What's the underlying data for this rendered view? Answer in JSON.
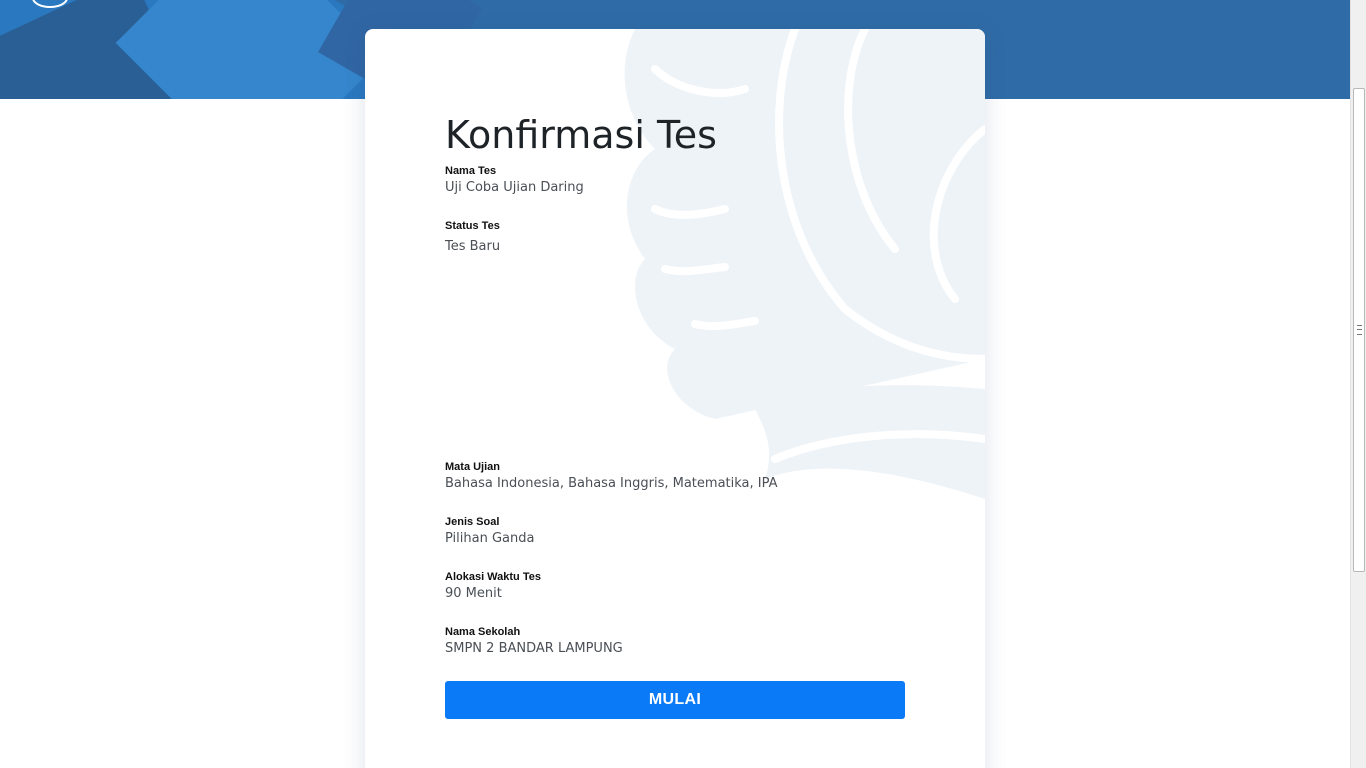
{
  "card": {
    "title": "Konfirmasi Tes",
    "fields": [
      {
        "label": "Nama Tes",
        "value": "Uji Coba Ujian Daring"
      },
      {
        "label": "Status Tes",
        "value": "Tes Baru"
      },
      {
        "label": "Mata Ujian",
        "value": "Bahasa Indonesia, Bahasa Inggris, Matematika, IPA"
      },
      {
        "label": "Jenis Soal",
        "value": "Pilihan Ganda"
      },
      {
        "label": "Alokasi Waktu Tes",
        "value": "90 Menit"
      },
      {
        "label": "Nama Sekolah",
        "value": "SMPN 2 BANDAR LAMPUNG"
      }
    ],
    "start_label": "MULAI"
  },
  "colors": {
    "banner": "#2f6ba6",
    "button": "#0a7af7",
    "watermark": "#eef3f8"
  },
  "icons": {
    "banner_logo": "logo-icon",
    "watermark": "eagle-watermark-icon",
    "scroll_grip": "scroll-grip-icon"
  }
}
